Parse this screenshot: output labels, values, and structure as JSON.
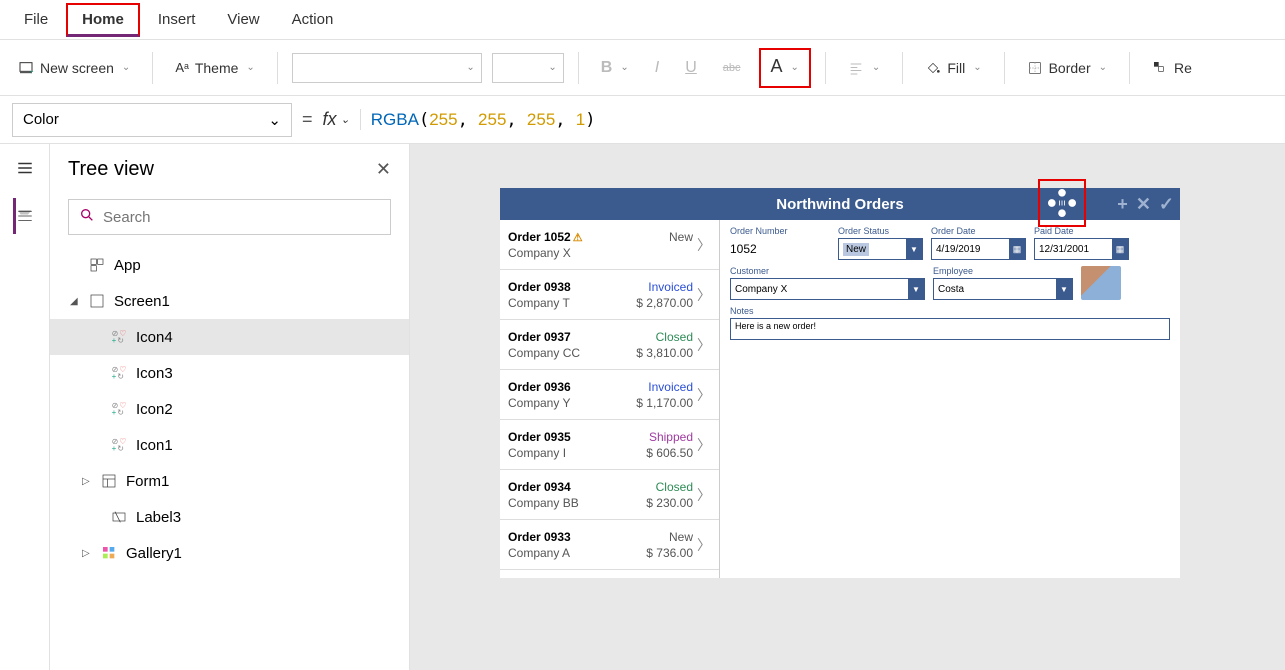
{
  "menubar": {
    "file": "File",
    "home": "Home",
    "insert": "Insert",
    "view": "View",
    "action": "Action"
  },
  "ribbon": {
    "new_screen": "New screen",
    "theme": "Theme",
    "fill": "Fill",
    "border": "Border",
    "reorder_partial": "Re"
  },
  "formulabar": {
    "property": "Color",
    "fx": "fx",
    "formula_fn": "RGBA",
    "formula_args": [
      "255",
      "255",
      "255",
      "1"
    ]
  },
  "treeview": {
    "title": "Tree view",
    "search_placeholder": "Search",
    "items": {
      "app": "App",
      "screen1": "Screen1",
      "icon4": "Icon4",
      "icon3": "Icon3",
      "icon2": "Icon2",
      "icon1": "Icon1",
      "form1": "Form1",
      "label3": "Label3",
      "gallery1": "Gallery1"
    }
  },
  "app": {
    "title": "Northwind Orders",
    "orders": [
      {
        "num": "Order 1052",
        "company": "Company X",
        "status": "New",
        "status_cls": "st-new",
        "amount": "",
        "warn": true
      },
      {
        "num": "Order 0938",
        "company": "Company T",
        "status": "Invoiced",
        "status_cls": "st-invoiced",
        "amount": "$ 2,870.00"
      },
      {
        "num": "Order 0937",
        "company": "Company CC",
        "status": "Closed",
        "status_cls": "st-closed",
        "amount": "$ 3,810.00"
      },
      {
        "num": "Order 0936",
        "company": "Company Y",
        "status": "Invoiced",
        "status_cls": "st-invoiced",
        "amount": "$ 1,170.00"
      },
      {
        "num": "Order 0935",
        "company": "Company I",
        "status": "Shipped",
        "status_cls": "st-shipped",
        "amount": "$ 606.50"
      },
      {
        "num": "Order 0934",
        "company": "Company BB",
        "status": "Closed",
        "status_cls": "st-closed",
        "amount": "$ 230.00"
      },
      {
        "num": "Order 0933",
        "company": "Company A",
        "status": "New",
        "status_cls": "st-new",
        "amount": "$ 736.00"
      }
    ],
    "form": {
      "order_number_label": "Order Number",
      "order_number": "1052",
      "order_status_label": "Order Status",
      "order_status": "New",
      "order_date_label": "Order Date",
      "order_date": "4/19/2019",
      "paid_date_label": "Paid Date",
      "paid_date": "12/31/2001",
      "customer_label": "Customer",
      "customer": "Company X",
      "employee_label": "Employee",
      "employee": "Costa",
      "notes_label": "Notes",
      "notes": "Here is a new order!"
    }
  }
}
